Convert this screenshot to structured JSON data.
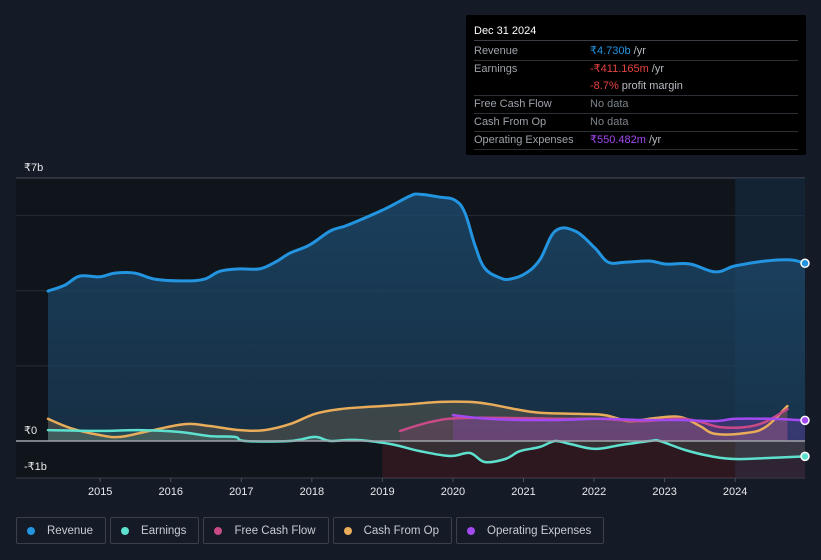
{
  "tooltip": {
    "date": "Dec 31 2024",
    "rows": [
      {
        "label": "Revenue",
        "value": "₹4.730b",
        "suffix": "/yr",
        "color": "#2394df"
      },
      {
        "label": "Earnings",
        "value": "-₹411.165m",
        "suffix": "/yr",
        "color": "#e64141"
      },
      {
        "label": "",
        "value": "-8.7%",
        "suffix": "profit margin",
        "color": "#e64141"
      },
      {
        "label": "Free Cash Flow",
        "value": "No data",
        "suffix": "",
        "color": "#7d838b"
      },
      {
        "label": "Cash From Op",
        "value": "No data",
        "suffix": "",
        "color": "#7d838b"
      },
      {
        "label": "Operating Expenses",
        "value": "₹550.482m",
        "suffix": "/yr",
        "color": "#a349f0"
      }
    ]
  },
  "legend": [
    {
      "label": "Revenue",
      "color": "#2394df"
    },
    {
      "label": "Earnings",
      "color": "#5ee0cf"
    },
    {
      "label": "Free Cash Flow",
      "color": "#c84a87"
    },
    {
      "label": "Cash From Op",
      "color": "#e9ac5a"
    },
    {
      "label": "Operating Expenses",
      "color": "#a349f0"
    }
  ],
  "chart_data": {
    "type": "area",
    "title": "",
    "xlabel": "",
    "ylabel": "",
    "ylim": [
      -1,
      7
    ],
    "y_tick_labels": [
      {
        "value": 7,
        "label": "₹7b"
      },
      {
        "value": 0,
        "label": "₹0"
      },
      {
        "value": -1,
        "label": "-₹1b"
      }
    ],
    "x_tick_labels": [
      "2015",
      "2016",
      "2017",
      "2018",
      "2019",
      "2020",
      "2021",
      "2022",
      "2023",
      "2024"
    ],
    "xlim": [
      2014.26,
      2024.99
    ],
    "highlight_range": [
      2024.0,
      2024.99
    ],
    "grid": true,
    "units": "₹ billions",
    "series": [
      {
        "name": "Revenue",
        "color": "#2394df",
        "x": [
          2014.26,
          2014.5,
          2014.71,
          2014.99,
          2015.21,
          2015.49,
          2015.77,
          2016.2,
          2016.48,
          2016.7,
          2016.98,
          2017.26,
          2017.48,
          2017.69,
          2017.97,
          2018.26,
          2018.47,
          2018.68,
          2019.04,
          2019.39,
          2019.53,
          2019.82,
          2020.03,
          2020.17,
          2020.31,
          2020.45,
          2020.67,
          2020.81,
          2021.02,
          2021.23,
          2021.45,
          2021.73,
          2022.01,
          2022.2,
          2022.44,
          2022.79,
          2023.01,
          2023.36,
          2023.72,
          2024.0,
          2024.43,
          2024.78,
          2024.99
        ],
        "values": [
          3.99,
          4.15,
          4.39,
          4.37,
          4.47,
          4.47,
          4.31,
          4.26,
          4.31,
          4.52,
          4.58,
          4.58,
          4.76,
          5.0,
          5.22,
          5.59,
          5.72,
          5.88,
          6.18,
          6.52,
          6.57,
          6.49,
          6.41,
          6.07,
          5.22,
          4.6,
          4.34,
          4.31,
          4.45,
          4.82,
          5.59,
          5.59,
          5.14,
          4.76,
          4.76,
          4.79,
          4.71,
          4.71,
          4.5,
          4.66,
          4.79,
          4.82,
          4.73
        ]
      },
      {
        "name": "Earnings",
        "color": "#5ee0cf",
        "x": [
          2014.26,
          2014.99,
          2015.56,
          2016.13,
          2016.55,
          2016.91,
          2017.05,
          2017.69,
          2018.04,
          2018.26,
          2018.61,
          2019.11,
          2019.53,
          2019.96,
          2020.24,
          2020.45,
          2020.74,
          2020.95,
          2021.23,
          2021.45,
          2021.66,
          2022.01,
          2022.37,
          2022.79,
          2022.93,
          2023.29,
          2023.64,
          2024.0,
          2024.5,
          2024.99
        ],
        "values": [
          0.29,
          0.27,
          0.29,
          0.24,
          0.13,
          0.11,
          0.0,
          0.0,
          0.11,
          0.0,
          0.03,
          -0.08,
          -0.27,
          -0.4,
          -0.32,
          -0.56,
          -0.48,
          -0.27,
          -0.16,
          0.0,
          -0.08,
          -0.21,
          -0.11,
          0.0,
          0.0,
          -0.24,
          -0.4,
          -0.48,
          -0.45,
          -0.41
        ]
      },
      {
        "name": "Free Cash Flow",
        "color": "#c84a87",
        "x": [
          2019.25,
          2019.69,
          2020.1,
          2020.96,
          2021.53,
          2022.09,
          2022.65,
          2023.22,
          2023.5,
          2023.79,
          2024.14,
          2024.43,
          2024.74
        ],
        "values": [
          0.27,
          0.51,
          0.61,
          0.61,
          0.59,
          0.59,
          0.53,
          0.59,
          0.51,
          0.37,
          0.37,
          0.51,
          0.85
        ]
      },
      {
        "name": "Cash From Op",
        "color": "#e9ac5a",
        "x": [
          2014.26,
          2014.57,
          2014.99,
          2015.28,
          2015.7,
          2016.2,
          2016.55,
          2016.98,
          2017.33,
          2017.69,
          2018.04,
          2018.4,
          2018.82,
          2019.25,
          2019.82,
          2020.24,
          2020.52,
          2020.88,
          2021.23,
          2021.8,
          2022.15,
          2022.5,
          2022.86,
          2023.22,
          2023.5,
          2023.72,
          2024.14,
          2024.43,
          2024.74
        ],
        "values": [
          0.59,
          0.35,
          0.16,
          0.11,
          0.27,
          0.45,
          0.4,
          0.29,
          0.29,
          0.45,
          0.72,
          0.85,
          0.91,
          0.96,
          1.04,
          1.04,
          0.98,
          0.85,
          0.75,
          0.72,
          0.69,
          0.53,
          0.61,
          0.64,
          0.4,
          0.19,
          0.21,
          0.37,
          0.93
        ]
      },
      {
        "name": "Operating Expenses",
        "color": "#a349f0",
        "x": [
          2020.0,
          2020.38,
          2020.95,
          2021.52,
          2022.09,
          2022.65,
          2023.22,
          2023.72,
          2024.0,
          2024.5,
          2024.99
        ],
        "values": [
          0.69,
          0.61,
          0.56,
          0.56,
          0.59,
          0.56,
          0.56,
          0.53,
          0.59,
          0.59,
          0.55
        ]
      }
    ]
  }
}
